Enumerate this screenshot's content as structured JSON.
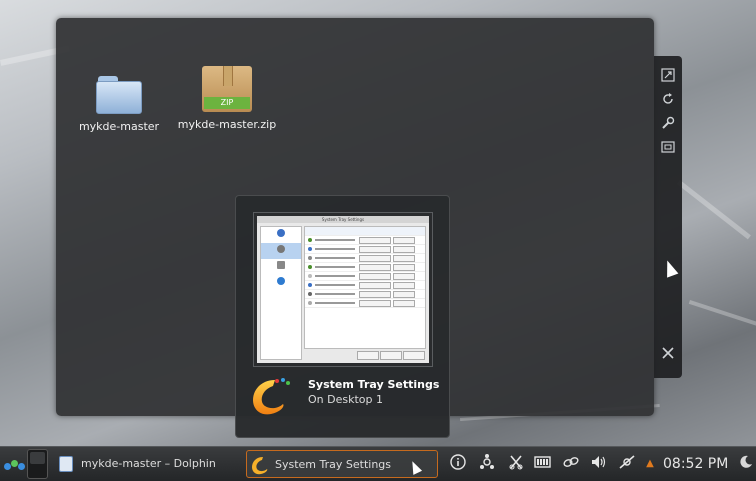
{
  "desktop": {
    "icons": [
      {
        "label": "mykde-master",
        "type": "folder"
      },
      {
        "label": "mykde-master.zip",
        "type": "zip",
        "badge": "ZIP"
      }
    ]
  },
  "widget_toolbar": {
    "buttons": [
      "resize-icon",
      "rotate-icon",
      "settings-wrench-icon",
      "activities-icon",
      "close-icon"
    ]
  },
  "tooltip": {
    "title": "System Tray Settings",
    "subtitle": "On Desktop 1",
    "thumbnail_title": "System Tray Settings"
  },
  "taskbar": {
    "tasks": [
      {
        "label": "mykde-master – Dolphin",
        "active": false
      },
      {
        "label": "System Tray Settings",
        "active": true
      }
    ],
    "tray_icons": [
      "info-icon",
      "network-icon",
      "klipper-icon",
      "battery-icon",
      "link-icon",
      "volume-icon",
      "connection-icon",
      "expand-arrow-icon"
    ],
    "clock": "08:52 PM"
  },
  "colors": {
    "accent_orange": "#c66a1e",
    "panel_bg": "#2f3133",
    "folderview_bg": "#303234"
  }
}
